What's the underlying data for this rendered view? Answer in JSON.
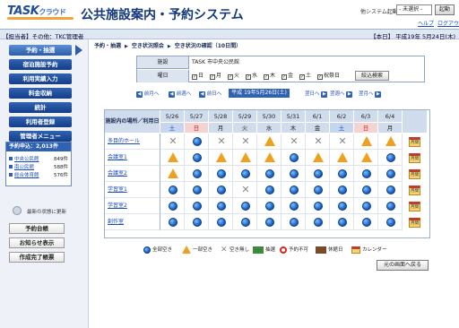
{
  "header": {
    "logo": "TASK",
    "logo_sub": "クラウド",
    "title": "公共施設案内・予約システム",
    "other_system_label": "他システム起動：",
    "system_select": "- 未選択 -",
    "launch_button": "起動",
    "help_link": "ヘルプ",
    "logout_link": "ログアウト"
  },
  "infobar": {
    "role": "【担当者】その他：TKC管理者",
    "date": "【本日】 平成19年 5月24日(木)"
  },
  "sidebar": {
    "active_item": "予約・抽選",
    "items": [
      "宿泊施設予約",
      "利用実績入力",
      "料金収納",
      "統計",
      "利用者登録",
      "管理者メニュー"
    ],
    "counts_title": "予約申込：2,013件",
    "counts": [
      {
        "name": "中央公民館",
        "value": "849件"
      },
      {
        "name": "南公民館",
        "value": "588件"
      },
      {
        "name": "総合体育館",
        "value": "576件"
      }
    ],
    "refresh": "最新の状態に更新",
    "buttons": [
      "予約台帳",
      "お知らせ表示",
      "作成完了帳票"
    ]
  },
  "breadcrumb": {
    "items": [
      "予約・抽選",
      "空き状況照会",
      "空き状況の確認（10日間）"
    ]
  },
  "filter": {
    "facility_label": "施設",
    "facility_value": "TASK 市中央公民館",
    "days_label": "曜日",
    "days": [
      "日",
      "月",
      "火",
      "水",
      "木",
      "金",
      "土",
      "祝祭日"
    ],
    "narrow_button": "絞込検索"
  },
  "nav": {
    "prev_month": "前月へ",
    "prev_week": "前週へ",
    "prev_day": "前日へ",
    "current": "平成 19年5月26日(土)",
    "next_day": "翌日へ",
    "next_week": "翌週へ",
    "next_month": "翌月へ"
  },
  "table": {
    "header_label": "施設内の場所／利用日",
    "dates": [
      "5/26",
      "5/27",
      "5/28",
      "5/29",
      "5/30",
      "5/31",
      "6/1",
      "6/2",
      "6/3",
      "6/4"
    ],
    "days": [
      "土",
      "日",
      "月",
      "火",
      "水",
      "木",
      "金",
      "土",
      "日",
      "月"
    ],
    "day_colors": [
      "#1a4bbf",
      "#c8201a",
      "#222",
      "#222",
      "#222",
      "#222",
      "#222",
      "#1a4bbf",
      "#c8201a",
      "#222"
    ],
    "rows": [
      {
        "name": "多目的ホール",
        "status": [
          "x",
          "circle",
          "x",
          "x",
          "tri",
          "x",
          "x",
          "x",
          "tri",
          "tri"
        ]
      },
      {
        "name": "会議室1",
        "status": [
          "tri",
          "circle",
          "tri",
          "tri",
          "tri",
          "circle",
          "tri",
          "tri",
          "tri",
          "circle"
        ]
      },
      {
        "name": "会議室2",
        "status": [
          "tri",
          "circle",
          "circle",
          "circle",
          "circle",
          "circle",
          "circle",
          "circle",
          "circle",
          "circle"
        ]
      },
      {
        "name": "学習室1",
        "status": [
          "circle",
          "circle",
          "circle",
          "x",
          "circle",
          "circle",
          "circle",
          "circle",
          "circle",
          "circle"
        ]
      },
      {
        "name": "学習室2",
        "status": [
          "circle",
          "circle",
          "circle",
          "circle",
          "circle",
          "circle",
          "circle",
          "circle",
          "circle",
          "circle"
        ]
      },
      {
        "name": "創作室",
        "status": [
          "circle",
          "circle",
          "circle",
          "circle",
          "circle",
          "circle",
          "circle",
          "circle",
          "circle",
          "circle"
        ]
      }
    ],
    "calendar_label": "月間"
  },
  "legend": {
    "items": [
      "全部空き",
      "一部空き",
      "空き無し",
      "抽選",
      "予約不可",
      "休館日",
      "カレンダー"
    ],
    "back_button": "元の画面へ戻る"
  }
}
